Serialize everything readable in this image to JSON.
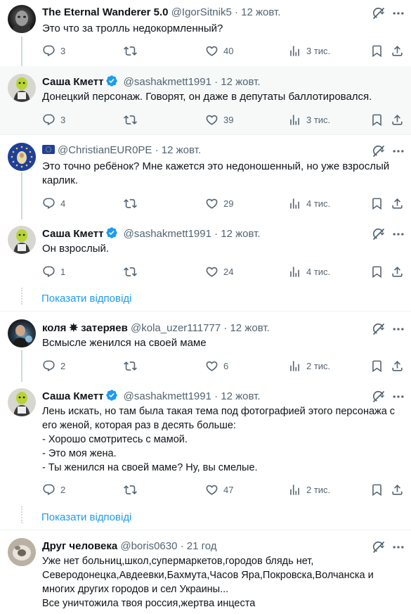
{
  "tweets": [
    {
      "name": "The Eternal Wanderer 5.0",
      "handle": "@IgorSitnik5",
      "time": "· 12 жовт.",
      "text": "Это что за тролль недокормленный?",
      "replies": "3",
      "retweets": "",
      "likes": "40",
      "views": "3 тис."
    },
    {
      "name": "Саша Кметт",
      "handle": "@sashakmett1991",
      "time": "· 12 жовт.",
      "text": "Донецкий персонаж. Говорят, он даже в депутаты баллотировался.",
      "replies": "3",
      "retweets": "",
      "likes": "39",
      "views": "3 тис."
    },
    {
      "name": "",
      "handle": "@ChristianEUR0PE",
      "time": "· 12 жовт.",
      "text": "Это точно ребёнок? Мне кажется это недоношенный, но уже взрослый карлик.",
      "replies": "4",
      "retweets": "",
      "likes": "29",
      "views": "4 тис."
    },
    {
      "name": "Саша Кметт",
      "handle": "@sashakmett1991",
      "time": "· 12 жовт.",
      "text": "Он взрослый.",
      "replies": "1",
      "retweets": "",
      "likes": "24",
      "views": "4 тис."
    },
    {
      "name": "коля ✵ затеряев",
      "handle": "@kola_uzer111777",
      "time": "· 12 жовт.",
      "text": "Всмысле женился на своей маме",
      "replies": "2",
      "retweets": "",
      "likes": "6",
      "views": "2 тис."
    },
    {
      "name": "Саша Кметт",
      "handle": "@sashakmett1991",
      "time": "· 12 жовт.",
      "text": "Лень искать, но там была такая тема под фотографией этого персонажа с\nего женой, которая раз в десять больше:\n- Хорошо смотритесь с мамой.\n- Это моя жена.\n- Ты женился на своей маме? Ну, вы смелые.",
      "replies": "2",
      "retweets": "",
      "likes": "47",
      "views": "2 тис."
    },
    {
      "name": "Друг человека",
      "handle": "@boris0630",
      "time": "· 21 год",
      "text": "Уже нет больниц,школ,супермаркетов,городов блядь нет,\nСеверодонецка,Авдеевки,Бахмута,Часов Яра,Покровска,Волчанска и\nмногих других городов и сел Украины...\nВсе уничтожила твоя россия,жертва инцеста"
    }
  ],
  "show_replies_label": "Показати відповіді",
  "colors": {
    "accent": "#1d9bf0",
    "muted": "#536471",
    "verified": "#1d9bf0",
    "highlight": "#f7f9f9"
  },
  "icons": [
    "grok-icon",
    "more-icon",
    "reply-icon",
    "retweet-icon",
    "like-icon",
    "views-icon",
    "bookmark-icon",
    "share-icon",
    "verified-icon",
    "eu-flag-icon"
  ]
}
